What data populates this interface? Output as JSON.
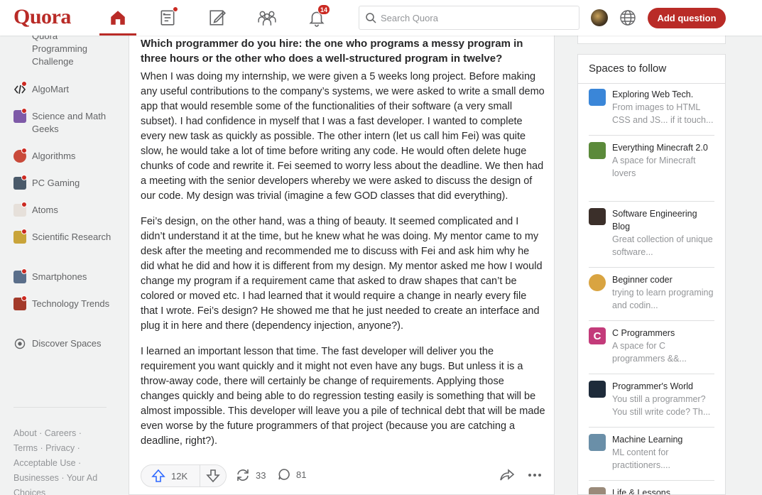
{
  "header": {
    "logo": "Quora",
    "notifications_count": "14",
    "search_placeholder": "Search Quora",
    "add_question": "Add question"
  },
  "sidebar": {
    "items": [
      {
        "label": "Quora Programming Challenge",
        "icon": "quora-challenge-icon"
      },
      {
        "label": "AlgoMart",
        "icon": "code-brackets-icon"
      },
      {
        "label": "Science and Math Geeks",
        "icon": "science-icon"
      },
      {
        "label": "Algorithms",
        "icon": "algorithms-icon"
      },
      {
        "label": "PC Gaming",
        "icon": "pc-gaming-icon"
      },
      {
        "label": "Atoms",
        "icon": "atom-icon"
      },
      {
        "label": "Scientific Research",
        "icon": "research-icon"
      },
      {
        "label": "Smartphones",
        "icon": "smartphone-icon"
      },
      {
        "label": "Technology Trends",
        "icon": "tech-trends-icon"
      },
      {
        "label": "Discover Spaces",
        "icon": "compass-icon"
      }
    ],
    "footer": [
      "About",
      "Careers",
      "Terms",
      "Privacy",
      "Acceptable Use",
      "Businesses",
      "Your Ad Choices"
    ]
  },
  "question": {
    "title": "Which programmer do you hire: the one who programs a messy program in three hours or the other who does a well-structured program in twelve?",
    "paragraphs": [
      "When I was doing my internship, we were given a 5 weeks long project. Before making any useful contributions to the company’s systems, we were asked to write a small demo app that would resemble some of the functionalities of their software (a very small subset). I had confidence in myself that I was a fast developer. I wanted to complete every new task as quickly as possible. The other intern (let us call him Fei) was quite slow, he would take a lot of time before writing any code. He would often delete huge chunks of code and rewrite it. Fei seemed to worry less about the deadline. We then had a meeting with the senior developers whereby we were asked to discuss the design of our code. My design was trivial (imagine a few GOD classes that did everything).",
      "Fei’s design, on the other hand, was a thing of beauty. It seemed complicated and I didn’t understand it at the time, but he knew what he was doing. My mentor came to my desk after the meeting and recommended me to discuss with Fei and ask him why he did what he did and how it is different from my design. My mentor asked me how I would change my program if a requirement came that asked to draw shapes that can’t be colored or moved etc. I had learned that it would require a change in nearly every file that I wrote. Fei’s design? He showed me that he just needed to create an interface and plug it in here and there (dependency injection, anyone?).",
      "I learned an important lesson that time. The fast developer will deliver you the requirement you want quickly and it might not even have any bugs. But unless it is a throw-away code, there will certainly be change of requirements. Applying those changes quickly and being able to do regression testing easily is something that will be almost impossible. This developer will leave you a pile of technical debt that will be made even worse by the future programmers of that project (because you are catching a deadline, right?)."
    ],
    "upvotes": "12K",
    "shares": "33",
    "comments": "81"
  },
  "spaces": {
    "title": "Spaces to follow",
    "items": [
      {
        "name": "Exploring Web Tech.",
        "desc": "From images to HTML CSS and JS... if it touch...",
        "color": "#3a86d8"
      },
      {
        "name": "Everything Minecraft 2.0",
        "desc": "A space for Minecraft lovers",
        "color": "#5b8a3a"
      },
      {
        "name": "Software Engineering Blog",
        "desc": "Great collection of unique software...",
        "color": "#3b2f2a"
      },
      {
        "name": "Beginner coder",
        "desc": "trying to learn programing and codin...",
        "color": "#d9a441"
      },
      {
        "name": "C Programmers",
        "desc": "A space for C programmers &&...",
        "color": "#c33b7a"
      },
      {
        "name": "Programmer's World",
        "desc": "You still a programmer? You still write code? Th...",
        "color": "#1e2b3a"
      },
      {
        "name": "Machine Learning",
        "desc": "ML content for practitioners....",
        "color": "#6a8fa8"
      },
      {
        "name": "Life & Lessons",
        "desc": "",
        "color": "#9a8a7a"
      }
    ]
  }
}
